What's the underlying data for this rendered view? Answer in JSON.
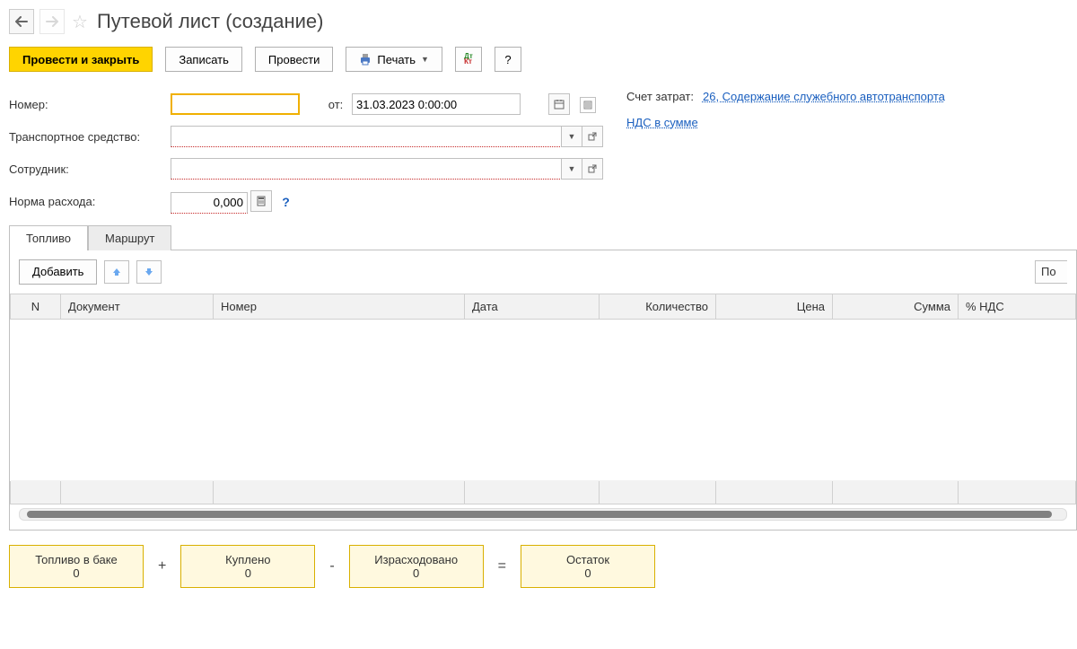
{
  "header": {
    "title": "Путевой лист (создание)"
  },
  "toolbar": {
    "submit_close": "Провести и закрыть",
    "save": "Записать",
    "submit": "Провести",
    "print": "Печать",
    "help": "?"
  },
  "form": {
    "number_label": "Номер:",
    "number_value": "",
    "from_label": "от:",
    "date_value": "31.03.2023 0:00:00",
    "vehicle_label": "Транспортное средство:",
    "vehicle_value": "",
    "employee_label": "Сотрудник:",
    "employee_value": "",
    "rate_label": "Норма расхода:",
    "rate_value": "0,000"
  },
  "right": {
    "cost_account_label": "Счет затрат:",
    "cost_account_link": "26, Содержание служебного автотранспорта",
    "vat_link": "НДС в сумме"
  },
  "tabs": {
    "fuel": "Топливо",
    "route": "Маршрут"
  },
  "fuel_toolbar": {
    "add": "Добавить",
    "search_fragment": "По"
  },
  "columns": {
    "n": "N",
    "document": "Документ",
    "number": "Номер",
    "date": "Дата",
    "qty": "Количество",
    "price": "Цена",
    "sum": "Сумма",
    "vat": "% НДС"
  },
  "summary": {
    "tank_label": "Топливо в баке",
    "tank_value": "0",
    "bought_label": "Куплено",
    "bought_value": "0",
    "spent_label": "Израсходовано",
    "spent_value": "0",
    "remain_label": "Остаток",
    "remain_value": "0",
    "plus": "+",
    "minus": "-",
    "equals": "="
  }
}
